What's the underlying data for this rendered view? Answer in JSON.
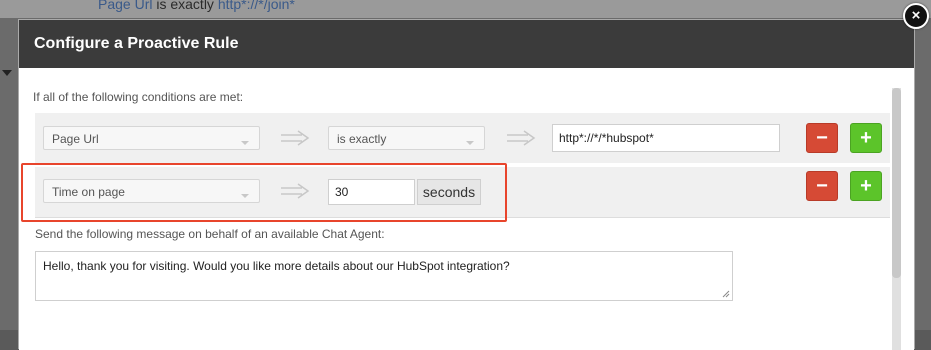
{
  "background": {
    "field_label": "Page Url",
    "operator_text": "is exactly",
    "value_text": "http*://*/join*"
  },
  "modal": {
    "title": "Configure a Proactive Rule",
    "conditions_intro": "If all of the following conditions are met:",
    "conditions": [
      {
        "field": "Page Url",
        "operator": "is exactly",
        "value": "http*://*/*hubspot*",
        "remove_label": "−",
        "add_label": "+"
      },
      {
        "field": "Time on page",
        "value": "30",
        "unit": "seconds",
        "remove_label": "−",
        "add_label": "+"
      }
    ],
    "send_label": "Send the following message on behalf of an available Chat Agent:",
    "message": "Hello, thank you for visiting. Would you like more details about our HubSpot integration?",
    "close_label": "×"
  },
  "colors": {
    "header": "#3b3b3b",
    "remove_button": "#d64a35",
    "add_button": "#5cc42a",
    "highlight": "#e8452c"
  },
  "icons": {
    "arrow": "arrow-right-icon",
    "close": "close-icon",
    "dropdown": "chevron-down-icon"
  }
}
